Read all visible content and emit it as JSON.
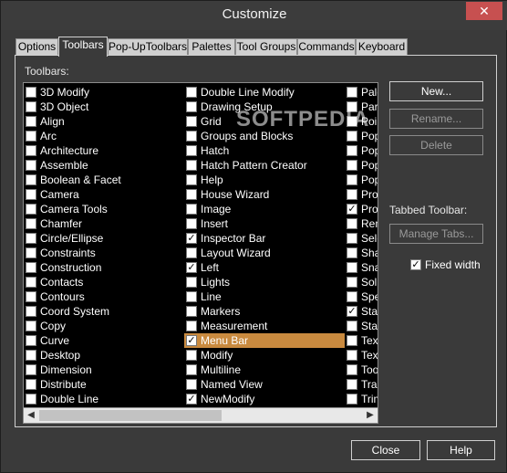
{
  "window": {
    "title": "Customize",
    "close_glyph": "✕"
  },
  "tabs": [
    {
      "label": "Options"
    },
    {
      "label": "Toolbars"
    },
    {
      "label": "Pop-UpToolbars"
    },
    {
      "label": "Palettes"
    },
    {
      "label": "Tool Groups"
    },
    {
      "label": "Commands"
    },
    {
      "label": "Keyboard"
    }
  ],
  "toolbars_label": "Toolbars:",
  "list": {
    "col1": [
      {
        "label": "3D Modify",
        "checked": false
      },
      {
        "label": "3D Object",
        "checked": false
      },
      {
        "label": "Align",
        "checked": false
      },
      {
        "label": "Arc",
        "checked": false
      },
      {
        "label": "Architecture",
        "checked": false
      },
      {
        "label": "Assemble",
        "checked": false
      },
      {
        "label": "Boolean & Facet",
        "checked": false
      },
      {
        "label": "Camera",
        "checked": false
      },
      {
        "label": "Camera Tools",
        "checked": false
      },
      {
        "label": "Chamfer",
        "checked": false
      },
      {
        "label": "Circle/Ellipse",
        "checked": false
      },
      {
        "label": "Constraints",
        "checked": false
      },
      {
        "label": "Construction",
        "checked": false
      },
      {
        "label": "Contacts",
        "checked": false
      },
      {
        "label": "Contours",
        "checked": false
      },
      {
        "label": "Coord System",
        "checked": false
      },
      {
        "label": "Copy",
        "checked": false
      },
      {
        "label": "Curve",
        "checked": false
      },
      {
        "label": "Desktop",
        "checked": false
      },
      {
        "label": "Dimension",
        "checked": false
      },
      {
        "label": "Distribute",
        "checked": false
      },
      {
        "label": "Double Line",
        "checked": false
      }
    ],
    "col2": [
      {
        "label": "Double Line Modify",
        "checked": false
      },
      {
        "label": "Drawing Setup",
        "checked": false
      },
      {
        "label": "Grid",
        "checked": false
      },
      {
        "label": "Groups and Blocks",
        "checked": false
      },
      {
        "label": "Hatch",
        "checked": false
      },
      {
        "label": "Hatch Pattern Creator",
        "checked": false
      },
      {
        "label": "Help",
        "checked": false
      },
      {
        "label": "House Wizard",
        "checked": false
      },
      {
        "label": "Image",
        "checked": false
      },
      {
        "label": "Insert",
        "checked": false
      },
      {
        "label": "Inspector Bar",
        "checked": true
      },
      {
        "label": "Layout Wizard",
        "checked": false
      },
      {
        "label": "Left",
        "checked": true
      },
      {
        "label": "Lights",
        "checked": false
      },
      {
        "label": "Line",
        "checked": false
      },
      {
        "label": "Markers",
        "checked": false
      },
      {
        "label": "Measurement",
        "checked": false
      },
      {
        "label": "Menu Bar",
        "checked": true,
        "selected": true
      },
      {
        "label": "Modify",
        "checked": false
      },
      {
        "label": "Multiline",
        "checked": false
      },
      {
        "label": "Named View",
        "checked": false
      },
      {
        "label": "NewModify",
        "checked": true
      }
    ],
    "col3": [
      {
        "label": "Pale",
        "checked": false
      },
      {
        "label": "Para",
        "checked": false
      },
      {
        "label": "Poin",
        "checked": false
      },
      {
        "label": "Pop",
        "checked": false
      },
      {
        "label": "Pop",
        "checked": false
      },
      {
        "label": "Pop",
        "checked": false
      },
      {
        "label": "Pop",
        "checked": false
      },
      {
        "label": "Prod",
        "checked": false
      },
      {
        "label": "Prop",
        "checked": true
      },
      {
        "label": "Ren",
        "checked": false
      },
      {
        "label": "Sele",
        "checked": false
      },
      {
        "label": "Sha",
        "checked": false
      },
      {
        "label": "Sna",
        "checked": false
      },
      {
        "label": "Soli",
        "checked": false
      },
      {
        "label": "Spe",
        "checked": false
      },
      {
        "label": "Star",
        "checked": true
      },
      {
        "label": "Star",
        "checked": false
      },
      {
        "label": "Tex",
        "checked": false
      },
      {
        "label": "Tex",
        "checked": false
      },
      {
        "label": "Too",
        "checked": false
      },
      {
        "label": "Tran",
        "checked": false
      },
      {
        "label": "Trim",
        "checked": false
      }
    ]
  },
  "buttons": {
    "new": "New...",
    "rename": "Rename...",
    "delete": "Delete",
    "manage_tabs": "Manage Tabs...",
    "close": "Close",
    "help": "Help"
  },
  "tabbed_toolbar_label": "Tabbed Toolbar:",
  "fixed_width": {
    "label": "Fixed width",
    "checked": true
  },
  "scroll": {
    "left_glyph": "◀",
    "right_glyph": "▶"
  },
  "watermark": "SOFTPEDIA",
  "colors": {
    "selection": "#c98a3f",
    "list_bg": "#000000",
    "dialog_bg": "#3a3a3a"
  }
}
